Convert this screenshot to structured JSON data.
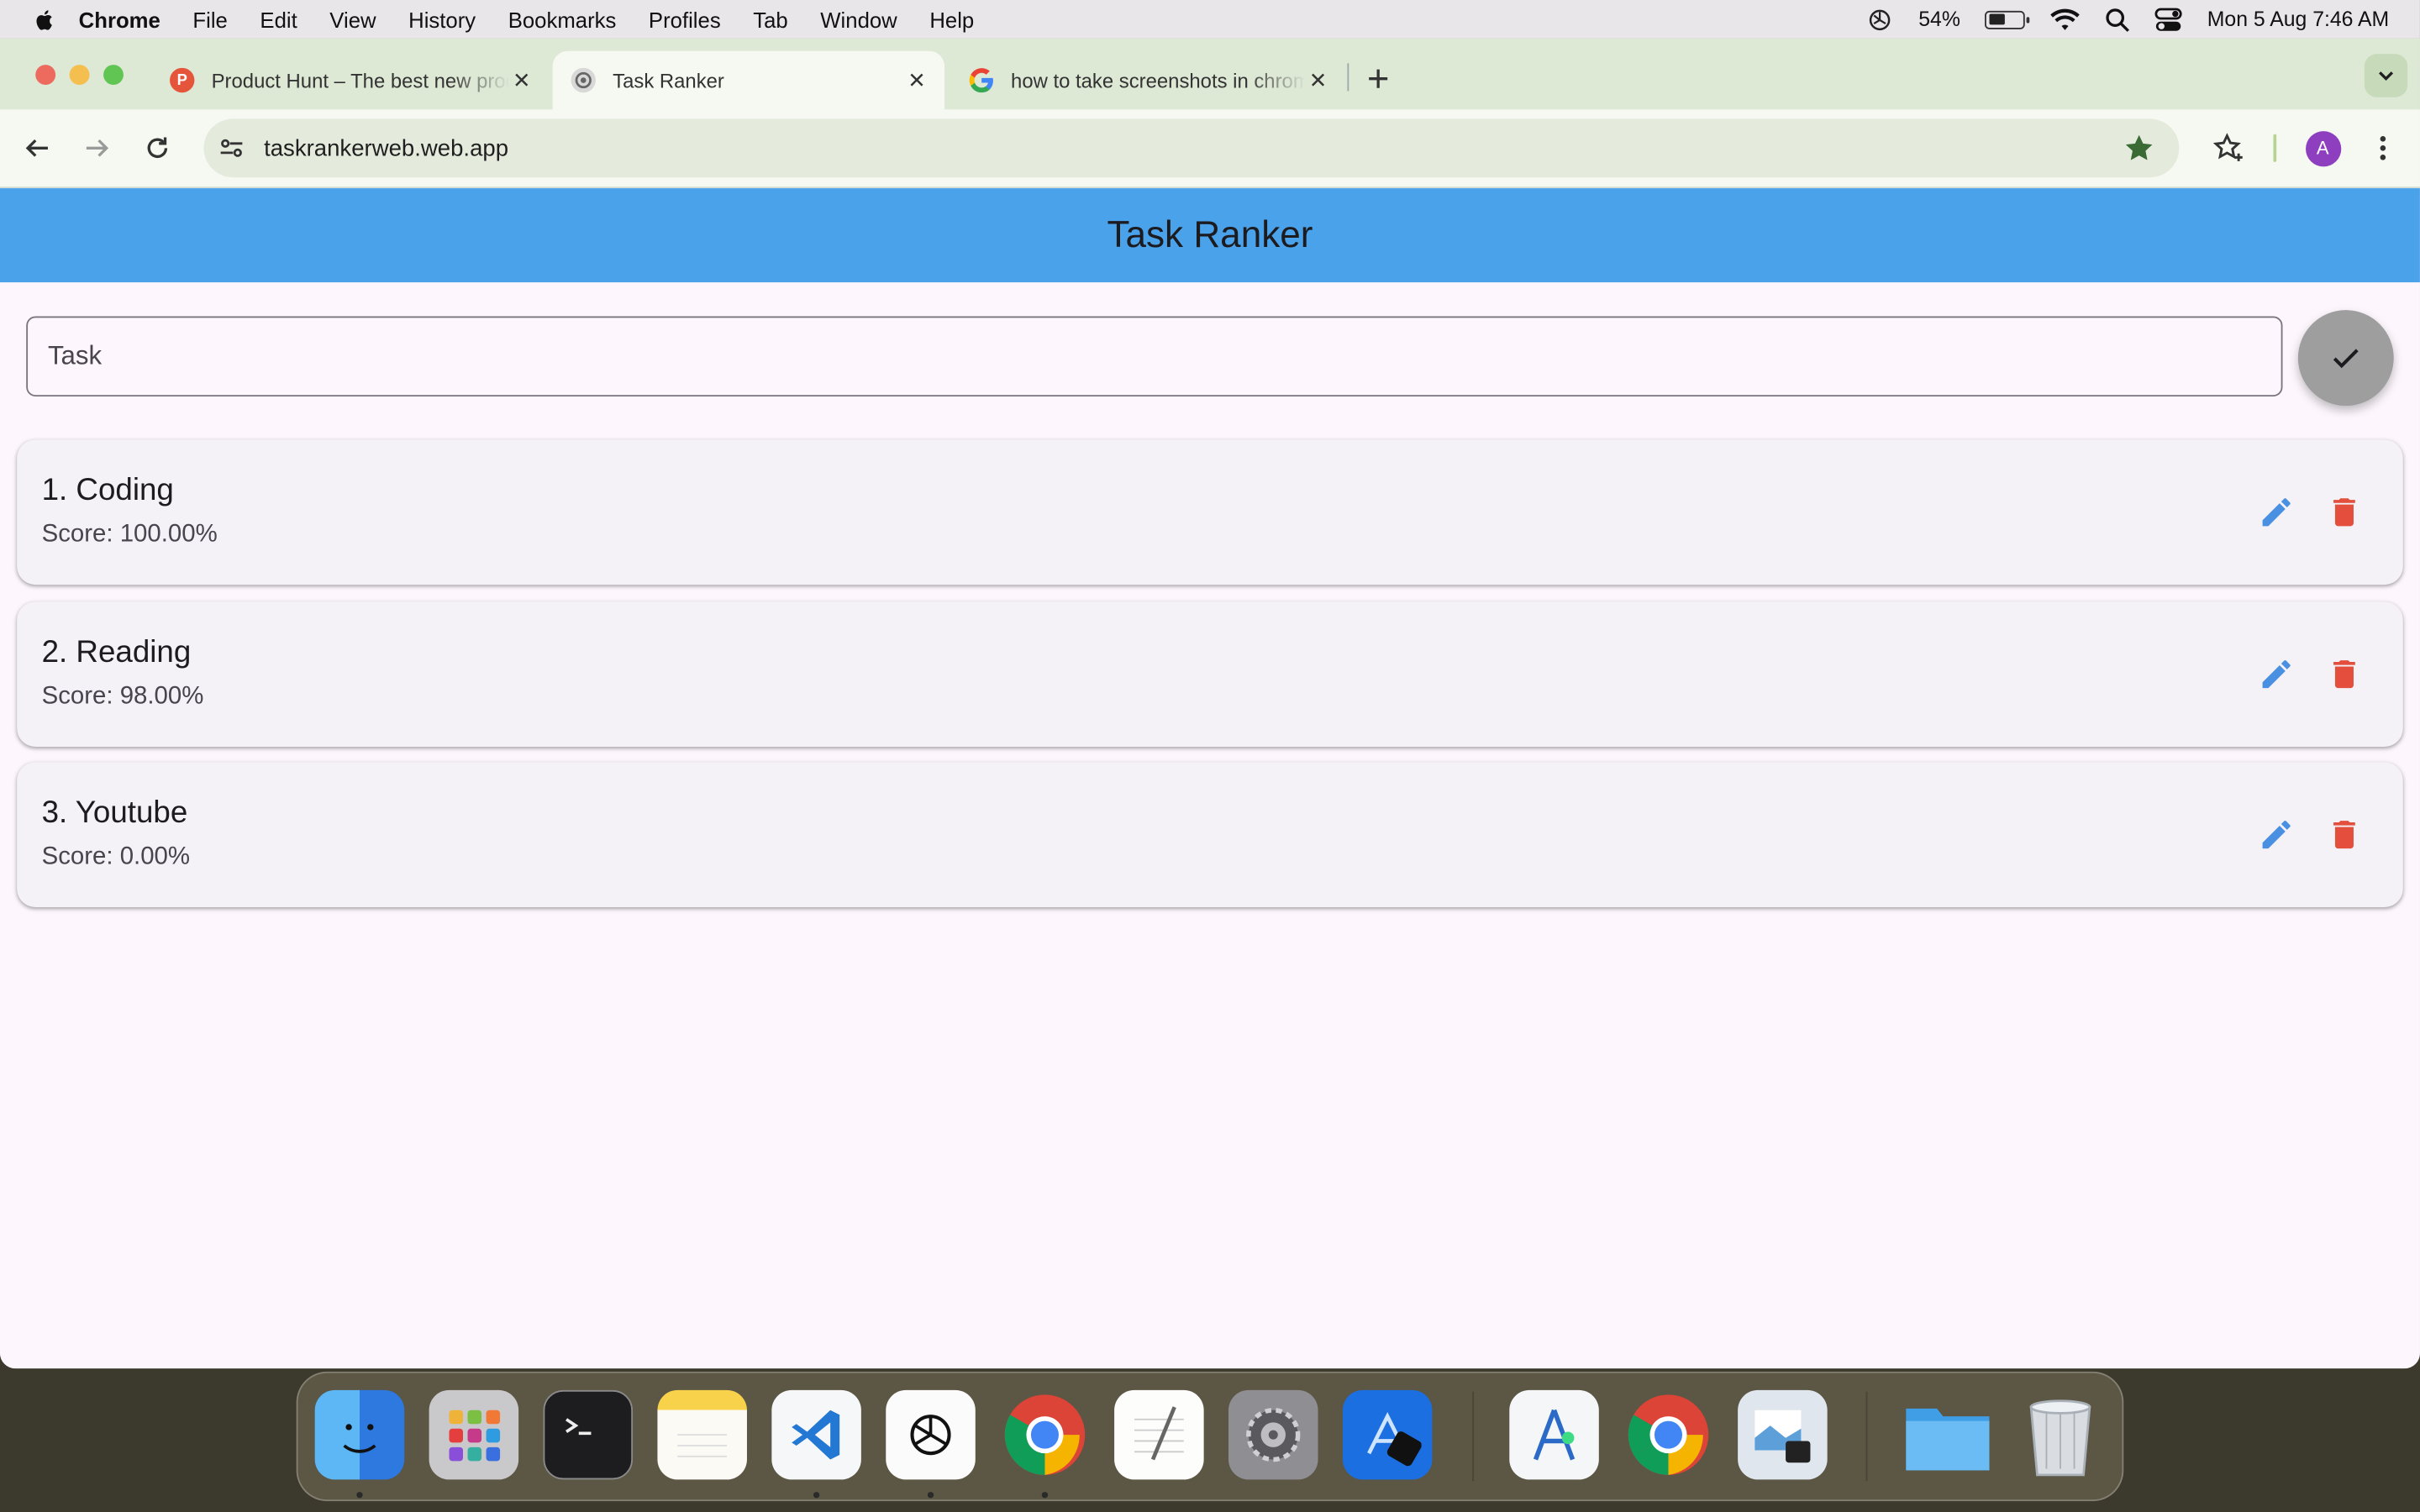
{
  "menubar": {
    "app_name": "Chrome",
    "menus": [
      "File",
      "Edit",
      "View",
      "History",
      "Bookmarks",
      "Profiles",
      "Tab",
      "Window",
      "Help"
    ],
    "battery_percent": "54%",
    "battery_level": 0.54,
    "datetime": "Mon 5 Aug  7:46 AM"
  },
  "tabs": [
    {
      "title": "Product Hunt – The best new products in tech",
      "favicon": "P",
      "favicon_color": "#e5553b"
    },
    {
      "title": "Task Ranker",
      "favicon": "",
      "favicon_color": "#8a8a8a"
    },
    {
      "title": "how to take screenshots in chrome",
      "favicon": "G",
      "favicon_color": "#ffffff"
    }
  ],
  "toolbar": {
    "url": "taskrankerweb.web.app",
    "profile_initial": "A"
  },
  "app": {
    "title": "Task Ranker",
    "input_placeholder": "Task",
    "accent_color": "#4aa3ea",
    "edit_color": "#4a90e2",
    "delete_color": "#e34f3c"
  },
  "tasks": [
    {
      "label": "1. Coding",
      "score": "Score: 100.00%"
    },
    {
      "label": "2. Reading",
      "score": "Score: 98.00%"
    },
    {
      "label": "3. Youtube",
      "score": "Score: 0.00%"
    }
  ],
  "dock": {
    "apps": [
      "finder-icon",
      "launchpad-icon",
      "terminal-icon",
      "notes-icon",
      "vscode-icon",
      "chatgpt-icon",
      "chrome-icon",
      "textedit-icon",
      "system-settings-icon",
      "xcode-icon",
      "android-studio-icon",
      "chrome-icon",
      "preview-icon",
      "folder-icon",
      "trash-icon"
    ]
  }
}
